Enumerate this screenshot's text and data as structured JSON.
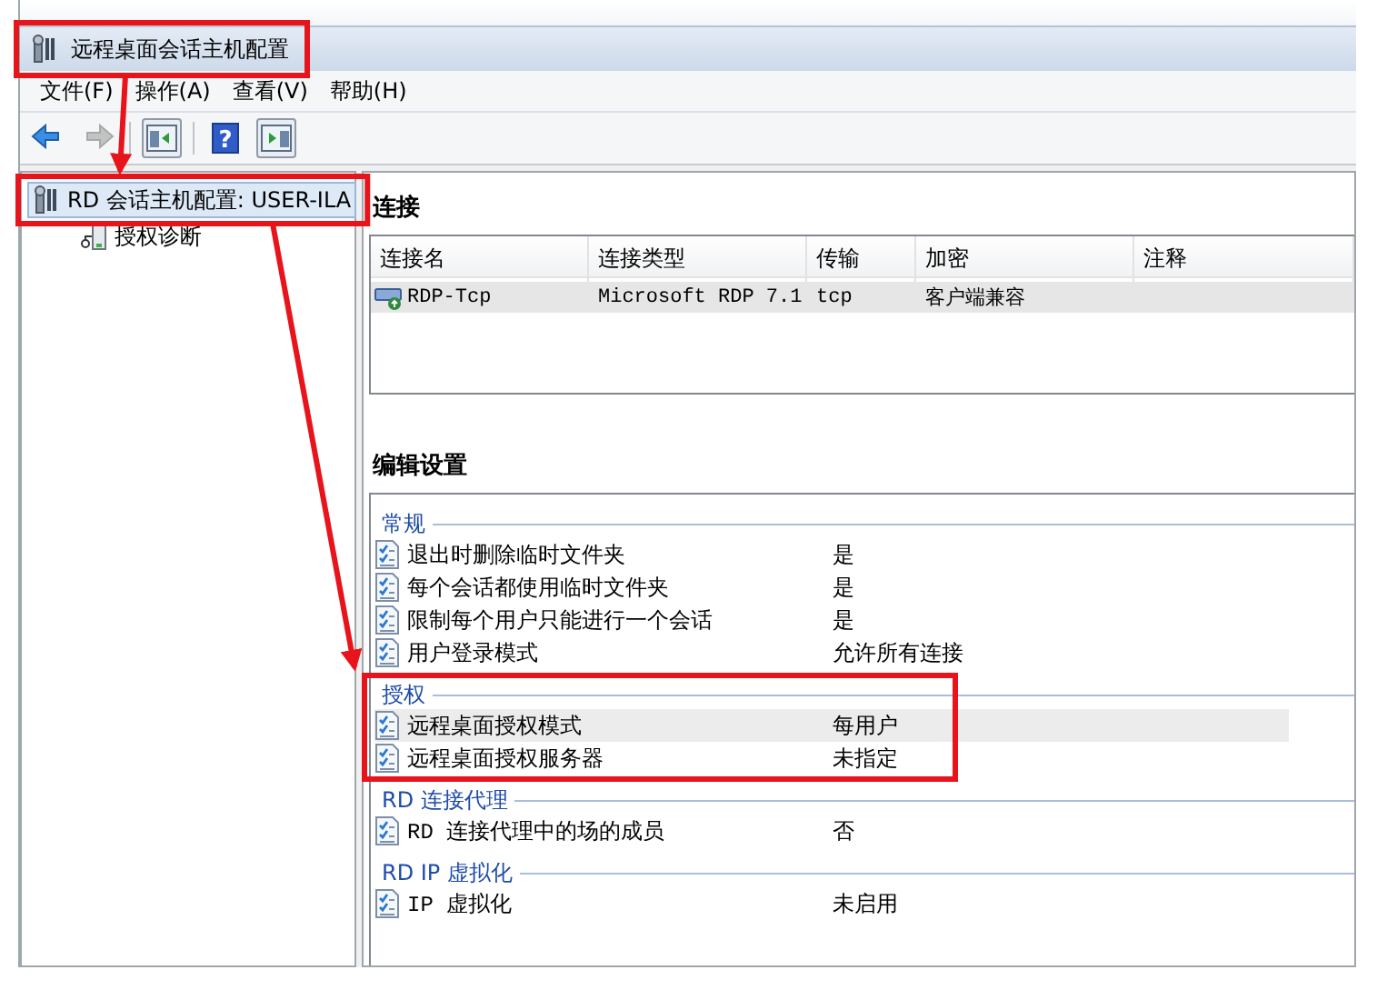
{
  "window": {
    "title": "远程桌面会话主机配置",
    "highlighted": true
  },
  "menu": [
    "文件(F)",
    "操作(A)",
    "查看(V)",
    "帮助(H)"
  ],
  "toolbar": [
    {
      "kind": "back",
      "disabled": false
    },
    {
      "kind": "forward",
      "disabled": true
    },
    {
      "kind": "tree-pane",
      "disabled": false
    },
    {
      "kind": "help",
      "disabled": false,
      "glyph": "?"
    },
    {
      "kind": "action-pane",
      "disabled": false
    }
  ],
  "tree": {
    "items": [
      {
        "label": "RD 会话主机配置: USER-ILA",
        "selected": true,
        "highlighted": true,
        "children": [
          {
            "label": "授权诊断",
            "selected": false,
            "highlighted": false
          }
        ]
      }
    ]
  },
  "connections": {
    "title": "连接",
    "columns": [
      "连接名",
      "连接类型",
      "传输",
      "加密",
      "注释"
    ],
    "rows": [
      {
        "cells": [
          "RDP-Tcp",
          "Microsoft RDP 7.1",
          "tcp",
          "客户端兼容"
        ],
        "selected": true
      }
    ]
  },
  "settings": {
    "title": "编辑设置",
    "groups": [
      {
        "title": "常规",
        "highlighted": false,
        "items": [
          {
            "name": "退出时删除临时文件夹",
            "value": "是",
            "selected": false
          },
          {
            "name": "每个会话都使用临时文件夹",
            "value": "是",
            "selected": false
          },
          {
            "name": "限制每个用户只能进行一个会话",
            "value": "是",
            "selected": false
          },
          {
            "name": "用户登录模式",
            "value": "允许所有连接",
            "selected": false
          }
        ]
      },
      {
        "title": "授权",
        "highlighted": true,
        "items": [
          {
            "name": "远程桌面授权模式",
            "value": "每用户",
            "selected": true
          },
          {
            "name": "远程桌面授权服务器",
            "value": "未指定",
            "selected": false
          }
        ]
      },
      {
        "title": "RD 连接代理",
        "highlighted": false,
        "items": [
          {
            "name": "RD 连接代理中的场的成员",
            "value": "否",
            "selected": false
          }
        ]
      },
      {
        "title": "RD IP 虚拟化",
        "highlighted": false,
        "items": [
          {
            "name": "IP 虚拟化",
            "value": "未启用",
            "selected": false
          }
        ]
      }
    ]
  }
}
